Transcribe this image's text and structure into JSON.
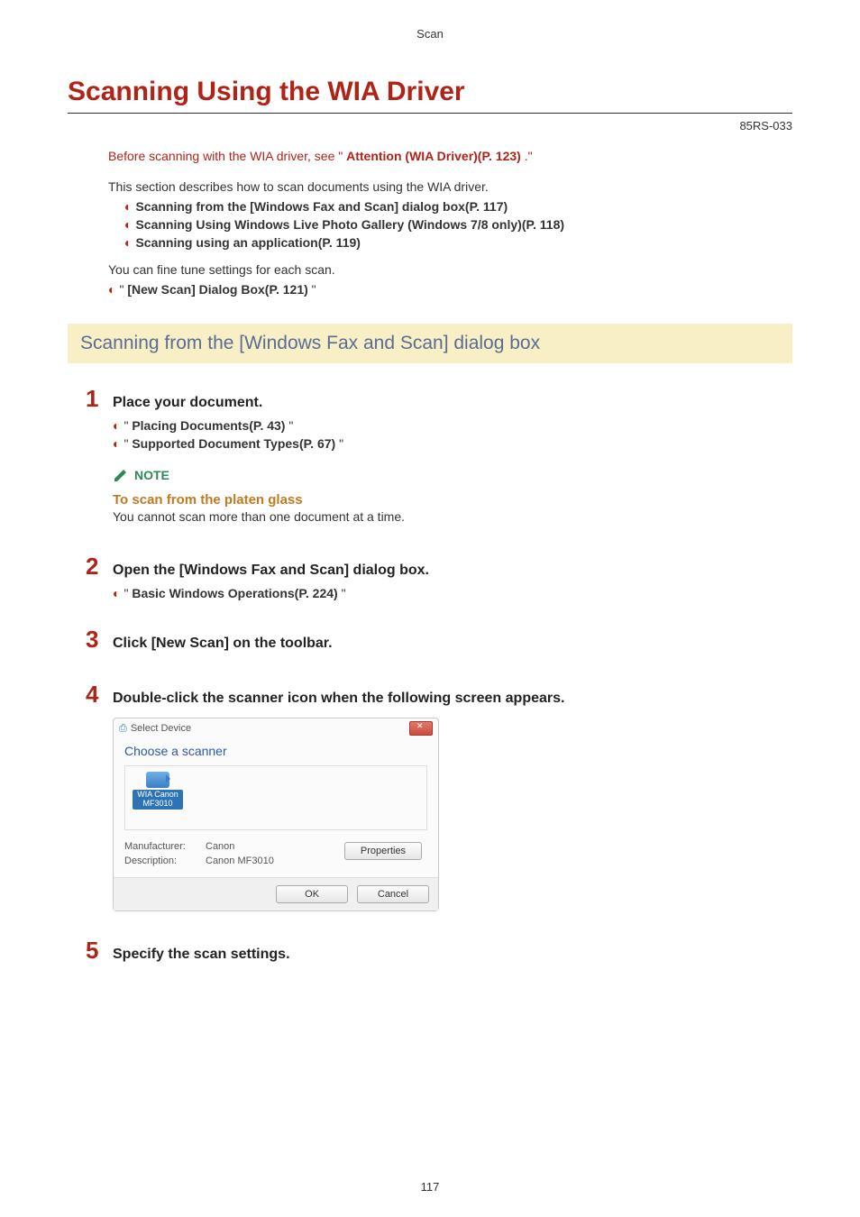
{
  "header": {
    "breadcrumb": "Scan"
  },
  "title": "Scanning Using the WIA Driver",
  "doc_id": "85RS-033",
  "warning": {
    "pre": "Before scanning with the WIA driver, see \" ",
    "link": "Attention (WIA Driver)(P. 123)",
    "post": " .\""
  },
  "intro1": "This section describes how to scan documents using the WIA driver.",
  "intro_links": [
    "Scanning from the [Windows Fax and Scan] dialog box(P. 117)",
    "Scanning Using Windows Live Photo Gallery (Windows 7/8 only)(P. 118)",
    "Scanning using an application(P. 119)"
  ],
  "intro2": "You can fine tune settings for each scan.",
  "intro2_link": {
    "pre": "\" ",
    "text": "[New Scan] Dialog Box(P. 121)",
    "post": " \""
  },
  "section_heading": "Scanning from the [Windows Fax and Scan] dialog box",
  "steps": {
    "s1": {
      "num": "1",
      "title": "Place your document.",
      "links": [
        {
          "pre": "\" ",
          "text": "Placing Documents(P. 43)",
          "post": " \""
        },
        {
          "pre": "\" ",
          "text": "Supported Document Types(P. 67)",
          "post": " \""
        }
      ],
      "note": {
        "label": "NOTE",
        "title": "To scan from the platen glass",
        "body": "You cannot scan more than one document at a time."
      }
    },
    "s2": {
      "num": "2",
      "title": "Open the [Windows Fax and Scan] dialog box.",
      "links": [
        {
          "pre": "\" ",
          "text": "Basic Windows Operations(P. 224)",
          "post": " \""
        }
      ]
    },
    "s3": {
      "num": "3",
      "title": "Click [New Scan] on the toolbar."
    },
    "s4": {
      "num": "4",
      "title": "Double-click the scanner icon when the following screen appears."
    },
    "s5": {
      "num": "5",
      "title": "Specify the scan settings."
    }
  },
  "dialog": {
    "title": "Select Device",
    "heading": "Choose a scanner",
    "device_label": "WIA Canon MF3010",
    "manufacturer_k": "Manufacturer:",
    "manufacturer_v": "Canon",
    "description_k": "Description:",
    "description_v": "Canon MF3010",
    "btn_properties": "Properties",
    "btn_ok": "OK",
    "btn_cancel": "Cancel"
  },
  "page_number": "117"
}
